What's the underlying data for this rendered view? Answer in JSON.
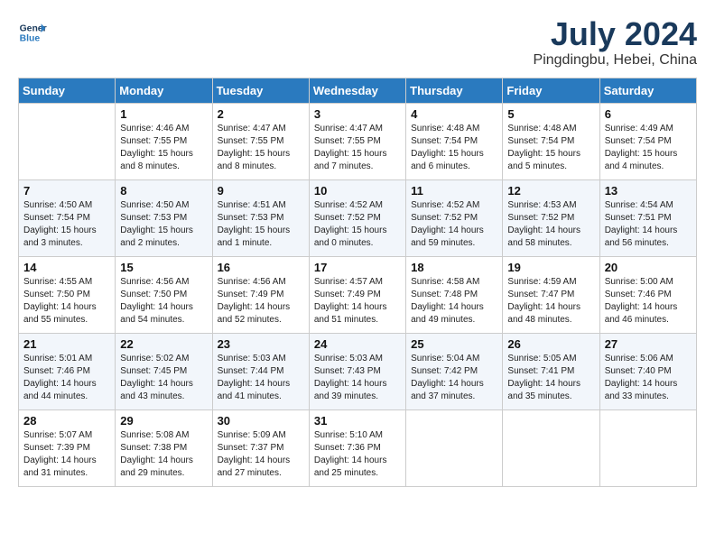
{
  "header": {
    "logo_line1": "General",
    "logo_line2": "Blue",
    "month": "July 2024",
    "location": "Pingdingbu, Hebei, China"
  },
  "weekdays": [
    "Sunday",
    "Monday",
    "Tuesday",
    "Wednesday",
    "Thursday",
    "Friday",
    "Saturday"
  ],
  "weeks": [
    [
      {
        "day": "",
        "sunrise": "",
        "sunset": "",
        "daylight": ""
      },
      {
        "day": "1",
        "sunrise": "Sunrise: 4:46 AM",
        "sunset": "Sunset: 7:55 PM",
        "daylight": "Daylight: 15 hours and 8 minutes."
      },
      {
        "day": "2",
        "sunrise": "Sunrise: 4:47 AM",
        "sunset": "Sunset: 7:55 PM",
        "daylight": "Daylight: 15 hours and 8 minutes."
      },
      {
        "day": "3",
        "sunrise": "Sunrise: 4:47 AM",
        "sunset": "Sunset: 7:55 PM",
        "daylight": "Daylight: 15 hours and 7 minutes."
      },
      {
        "day": "4",
        "sunrise": "Sunrise: 4:48 AM",
        "sunset": "Sunset: 7:54 PM",
        "daylight": "Daylight: 15 hours and 6 minutes."
      },
      {
        "day": "5",
        "sunrise": "Sunrise: 4:48 AM",
        "sunset": "Sunset: 7:54 PM",
        "daylight": "Daylight: 15 hours and 5 minutes."
      },
      {
        "day": "6",
        "sunrise": "Sunrise: 4:49 AM",
        "sunset": "Sunset: 7:54 PM",
        "daylight": "Daylight: 15 hours and 4 minutes."
      }
    ],
    [
      {
        "day": "7",
        "sunrise": "Sunrise: 4:50 AM",
        "sunset": "Sunset: 7:54 PM",
        "daylight": "Daylight: 15 hours and 3 minutes."
      },
      {
        "day": "8",
        "sunrise": "Sunrise: 4:50 AM",
        "sunset": "Sunset: 7:53 PM",
        "daylight": "Daylight: 15 hours and 2 minutes."
      },
      {
        "day": "9",
        "sunrise": "Sunrise: 4:51 AM",
        "sunset": "Sunset: 7:53 PM",
        "daylight": "Daylight: 15 hours and 1 minute."
      },
      {
        "day": "10",
        "sunrise": "Sunrise: 4:52 AM",
        "sunset": "Sunset: 7:52 PM",
        "daylight": "Daylight: 15 hours and 0 minutes."
      },
      {
        "day": "11",
        "sunrise": "Sunrise: 4:52 AM",
        "sunset": "Sunset: 7:52 PM",
        "daylight": "Daylight: 14 hours and 59 minutes."
      },
      {
        "day": "12",
        "sunrise": "Sunrise: 4:53 AM",
        "sunset": "Sunset: 7:52 PM",
        "daylight": "Daylight: 14 hours and 58 minutes."
      },
      {
        "day": "13",
        "sunrise": "Sunrise: 4:54 AM",
        "sunset": "Sunset: 7:51 PM",
        "daylight": "Daylight: 14 hours and 56 minutes."
      }
    ],
    [
      {
        "day": "14",
        "sunrise": "Sunrise: 4:55 AM",
        "sunset": "Sunset: 7:50 PM",
        "daylight": "Daylight: 14 hours and 55 minutes."
      },
      {
        "day": "15",
        "sunrise": "Sunrise: 4:56 AM",
        "sunset": "Sunset: 7:50 PM",
        "daylight": "Daylight: 14 hours and 54 minutes."
      },
      {
        "day": "16",
        "sunrise": "Sunrise: 4:56 AM",
        "sunset": "Sunset: 7:49 PM",
        "daylight": "Daylight: 14 hours and 52 minutes."
      },
      {
        "day": "17",
        "sunrise": "Sunrise: 4:57 AM",
        "sunset": "Sunset: 7:49 PM",
        "daylight": "Daylight: 14 hours and 51 minutes."
      },
      {
        "day": "18",
        "sunrise": "Sunrise: 4:58 AM",
        "sunset": "Sunset: 7:48 PM",
        "daylight": "Daylight: 14 hours and 49 minutes."
      },
      {
        "day": "19",
        "sunrise": "Sunrise: 4:59 AM",
        "sunset": "Sunset: 7:47 PM",
        "daylight": "Daylight: 14 hours and 48 minutes."
      },
      {
        "day": "20",
        "sunrise": "Sunrise: 5:00 AM",
        "sunset": "Sunset: 7:46 PM",
        "daylight": "Daylight: 14 hours and 46 minutes."
      }
    ],
    [
      {
        "day": "21",
        "sunrise": "Sunrise: 5:01 AM",
        "sunset": "Sunset: 7:46 PM",
        "daylight": "Daylight: 14 hours and 44 minutes."
      },
      {
        "day": "22",
        "sunrise": "Sunrise: 5:02 AM",
        "sunset": "Sunset: 7:45 PM",
        "daylight": "Daylight: 14 hours and 43 minutes."
      },
      {
        "day": "23",
        "sunrise": "Sunrise: 5:03 AM",
        "sunset": "Sunset: 7:44 PM",
        "daylight": "Daylight: 14 hours and 41 minutes."
      },
      {
        "day": "24",
        "sunrise": "Sunrise: 5:03 AM",
        "sunset": "Sunset: 7:43 PM",
        "daylight": "Daylight: 14 hours and 39 minutes."
      },
      {
        "day": "25",
        "sunrise": "Sunrise: 5:04 AM",
        "sunset": "Sunset: 7:42 PM",
        "daylight": "Daylight: 14 hours and 37 minutes."
      },
      {
        "day": "26",
        "sunrise": "Sunrise: 5:05 AM",
        "sunset": "Sunset: 7:41 PM",
        "daylight": "Daylight: 14 hours and 35 minutes."
      },
      {
        "day": "27",
        "sunrise": "Sunrise: 5:06 AM",
        "sunset": "Sunset: 7:40 PM",
        "daylight": "Daylight: 14 hours and 33 minutes."
      }
    ],
    [
      {
        "day": "28",
        "sunrise": "Sunrise: 5:07 AM",
        "sunset": "Sunset: 7:39 PM",
        "daylight": "Daylight: 14 hours and 31 minutes."
      },
      {
        "day": "29",
        "sunrise": "Sunrise: 5:08 AM",
        "sunset": "Sunset: 7:38 PM",
        "daylight": "Daylight: 14 hours and 29 minutes."
      },
      {
        "day": "30",
        "sunrise": "Sunrise: 5:09 AM",
        "sunset": "Sunset: 7:37 PM",
        "daylight": "Daylight: 14 hours and 27 minutes."
      },
      {
        "day": "31",
        "sunrise": "Sunrise: 5:10 AM",
        "sunset": "Sunset: 7:36 PM",
        "daylight": "Daylight: 14 hours and 25 minutes."
      },
      {
        "day": "",
        "sunrise": "",
        "sunset": "",
        "daylight": ""
      },
      {
        "day": "",
        "sunrise": "",
        "sunset": "",
        "daylight": ""
      },
      {
        "day": "",
        "sunrise": "",
        "sunset": "",
        "daylight": ""
      }
    ]
  ]
}
